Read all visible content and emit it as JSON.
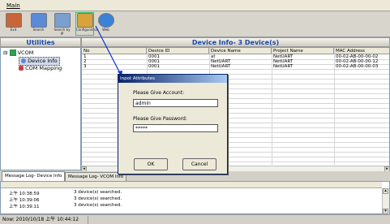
{
  "menu": {
    "main": "Main"
  },
  "toolbar": {
    "buttons": [
      {
        "label": "Exit",
        "color": "#c8663a"
      },
      {
        "label": "Search",
        "color": "#5a8ad8"
      },
      {
        "label": "Search by IP",
        "color": "#7aa0d0"
      },
      {
        "label": "Configuration",
        "color": "#d8a33a"
      },
      {
        "label": "Web",
        "color": "#3a82d8"
      }
    ]
  },
  "utilities": {
    "title": "Utilities",
    "tree": [
      {
        "label": "VCOM",
        "icon": "checkbox-icon",
        "expander": "⊟"
      },
      {
        "label": "Device Info",
        "icon": "device-icon"
      },
      {
        "label": "COM Mapping",
        "icon": "mapping-icon"
      }
    ]
  },
  "device_info": {
    "title": "Device Info- 3 Device(s)",
    "columns": [
      "No",
      "Device ID",
      "Device Name",
      "Project Name",
      "MAC Address"
    ],
    "rows": [
      [
        "1",
        "0001",
        "at",
        "NetUART",
        "00-02-AB-00-00-02"
      ],
      [
        "2",
        "0001",
        "NetUART",
        "NetUART",
        "00-02-AB-00-00-12"
      ],
      [
        "3",
        "0001",
        "NetUART",
        "NetUART",
        "00-02-AB-00-00-03"
      ]
    ]
  },
  "dialog": {
    "title": "Inpot Attributes",
    "account_label": "Please Give Account:",
    "account_value": "admin",
    "password_label": "Please Give Password:",
    "password_value": "*****",
    "ok": "OK",
    "cancel": "Cancel"
  },
  "messages": {
    "tabs": [
      "Message Log- Device Info",
      "Message Log- VCOM Info"
    ],
    "rows": [
      {
        "time": "上午 10:38:59",
        "text": "3 device(s) searched."
      },
      {
        "time": "上午 10:39:06",
        "text": "3 device(s) searched."
      },
      {
        "time": "上午 10:39:11",
        "text": "3 device(s) searched."
      }
    ]
  },
  "status": {
    "text": "Now: 2010/10/18 上午 10:44:12"
  },
  "colors": {
    "accent": "#1a4aa8",
    "selection_outline": "#36c36b",
    "dialog_title": "#0a246a"
  }
}
